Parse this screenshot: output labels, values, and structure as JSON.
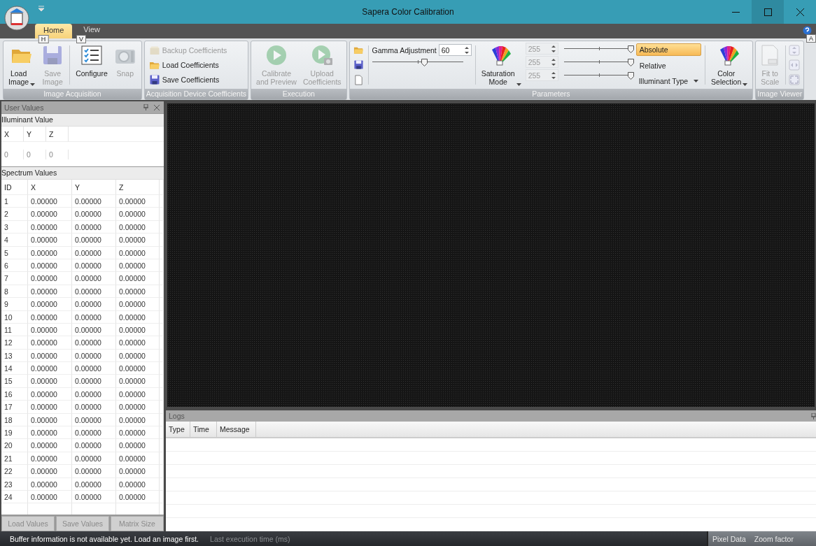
{
  "window": {
    "title": "Sapera Color Calibration"
  },
  "tabs": [
    {
      "label": "Home",
      "key_tip": "H",
      "selected": true
    },
    {
      "label": "View",
      "key_tip": "V",
      "selected": false
    }
  ],
  "help_key_tip": "A",
  "ribbon": [
    {
      "title": "Image Acquisition",
      "items": [
        {
          "kind": "large",
          "label": "Load\nImage",
          "dropdown": true,
          "disabled": false
        },
        {
          "kind": "large",
          "label": "Save\nImage",
          "dropdown": false,
          "disabled": true
        },
        {
          "kind": "separator"
        },
        {
          "kind": "large",
          "label": "Configure",
          "dropdown": false,
          "disabled": false
        },
        {
          "kind": "large",
          "label": "Snap",
          "dropdown": false,
          "disabled": true
        }
      ]
    },
    {
      "title": "Acquisition Device Coefficients",
      "items": [
        {
          "kind": "small-stack",
          "buttons": [
            {
              "label": "Backup Coefficients",
              "disabled": true
            },
            {
              "label": "Load Coefficients",
              "disabled": false
            },
            {
              "label": "Save Coefficients",
              "disabled": false
            }
          ]
        }
      ]
    },
    {
      "title": "Execution",
      "items": [
        {
          "kind": "large",
          "label": "Calibrate\nand Preview",
          "dropdown": false,
          "disabled": true
        },
        {
          "kind": "large",
          "label": "Upload\nCoefficients",
          "dropdown": false,
          "disabled": true
        }
      ]
    },
    {
      "title": "Parameters",
      "items": [
        {
          "kind": "icon-stack",
          "buttons": [
            {
              "disabled": false
            },
            {
              "disabled": false
            },
            {
              "disabled": false
            }
          ]
        },
        {
          "kind": "separator"
        },
        {
          "kind": "gamma",
          "label": "Gamma Adjustment",
          "value": "60",
          "level": 0.58
        },
        {
          "kind": "separator"
        },
        {
          "kind": "large",
          "label": "Saturation\nMode",
          "dropdown": true,
          "disabled": false
        },
        {
          "kind": "channels",
          "channels": [
            {
              "value": "255",
              "disabled": true,
              "level": 1
            },
            {
              "value": "255",
              "disabled": true,
              "level": 1
            },
            {
              "value": "255",
              "disabled": true,
              "level": 1
            }
          ]
        },
        {
          "kind": "options",
          "options": [
            {
              "label": "Absolute",
              "selected": true
            },
            {
              "label": "Relative",
              "selected": false
            }
          ],
          "dropdown_label": "Illuminant Type"
        },
        {
          "kind": "separator"
        },
        {
          "kind": "large",
          "label": "Color\nSelection",
          "dropdown": true,
          "disabled": false
        }
      ]
    },
    {
      "title": "Image Viewer",
      "items": [
        {
          "kind": "large",
          "label": "Fit to\nScale",
          "dropdown": false,
          "disabled": true
        },
        {
          "kind": "separator"
        },
        {
          "kind": "icon-stack",
          "buttons": [
            {
              "disabled": true
            },
            {
              "disabled": true
            },
            {
              "disabled": true
            }
          ]
        }
      ]
    }
  ],
  "user_values": {
    "title": "User Values",
    "illuminant": {
      "title": "Illuminant Value",
      "columns": [
        "X",
        "Y",
        "Z"
      ],
      "values": [
        "0",
        "0",
        "0"
      ]
    },
    "spectrum": {
      "title": "Spectrum Values",
      "columns": [
        "ID",
        "X",
        "Y",
        "Z"
      ],
      "rows": [
        [
          "1",
          "0.00000",
          "0.00000",
          "0.00000"
        ],
        [
          "2",
          "0.00000",
          "0.00000",
          "0.00000"
        ],
        [
          "3",
          "0.00000",
          "0.00000",
          "0.00000"
        ],
        [
          "4",
          "0.00000",
          "0.00000",
          "0.00000"
        ],
        [
          "5",
          "0.00000",
          "0.00000",
          "0.00000"
        ],
        [
          "6",
          "0.00000",
          "0.00000",
          "0.00000"
        ],
        [
          "7",
          "0.00000",
          "0.00000",
          "0.00000"
        ],
        [
          "8",
          "0.00000",
          "0.00000",
          "0.00000"
        ],
        [
          "9",
          "0.00000",
          "0.00000",
          "0.00000"
        ],
        [
          "10",
          "0.00000",
          "0.00000",
          "0.00000"
        ],
        [
          "11",
          "0.00000",
          "0.00000",
          "0.00000"
        ],
        [
          "12",
          "0.00000",
          "0.00000",
          "0.00000"
        ],
        [
          "13",
          "0.00000",
          "0.00000",
          "0.00000"
        ],
        [
          "14",
          "0.00000",
          "0.00000",
          "0.00000"
        ],
        [
          "15",
          "0.00000",
          "0.00000",
          "0.00000"
        ],
        [
          "16",
          "0.00000",
          "0.00000",
          "0.00000"
        ],
        [
          "17",
          "0.00000",
          "0.00000",
          "0.00000"
        ],
        [
          "18",
          "0.00000",
          "0.00000",
          "0.00000"
        ],
        [
          "19",
          "0.00000",
          "0.00000",
          "0.00000"
        ],
        [
          "20",
          "0.00000",
          "0.00000",
          "0.00000"
        ],
        [
          "21",
          "0.00000",
          "0.00000",
          "0.00000"
        ],
        [
          "22",
          "0.00000",
          "0.00000",
          "0.00000"
        ],
        [
          "23",
          "0.00000",
          "0.00000",
          "0.00000"
        ],
        [
          "24",
          "0.00000",
          "0.00000",
          "0.00000"
        ]
      ]
    },
    "buttons": [
      {
        "label": "Load Values",
        "disabled": true
      },
      {
        "label": "Save Values",
        "disabled": true
      },
      {
        "label": "Matrix Size",
        "disabled": true
      }
    ]
  },
  "logs": {
    "title": "Logs",
    "columns": [
      "Type",
      "Time",
      "Message"
    ]
  },
  "status_bar": {
    "message": "Buffer information is not available yet. Load an image first.",
    "execution_time": "Last execution time (ms)",
    "right": [
      "Pixel Data",
      "Zoom factor"
    ]
  }
}
